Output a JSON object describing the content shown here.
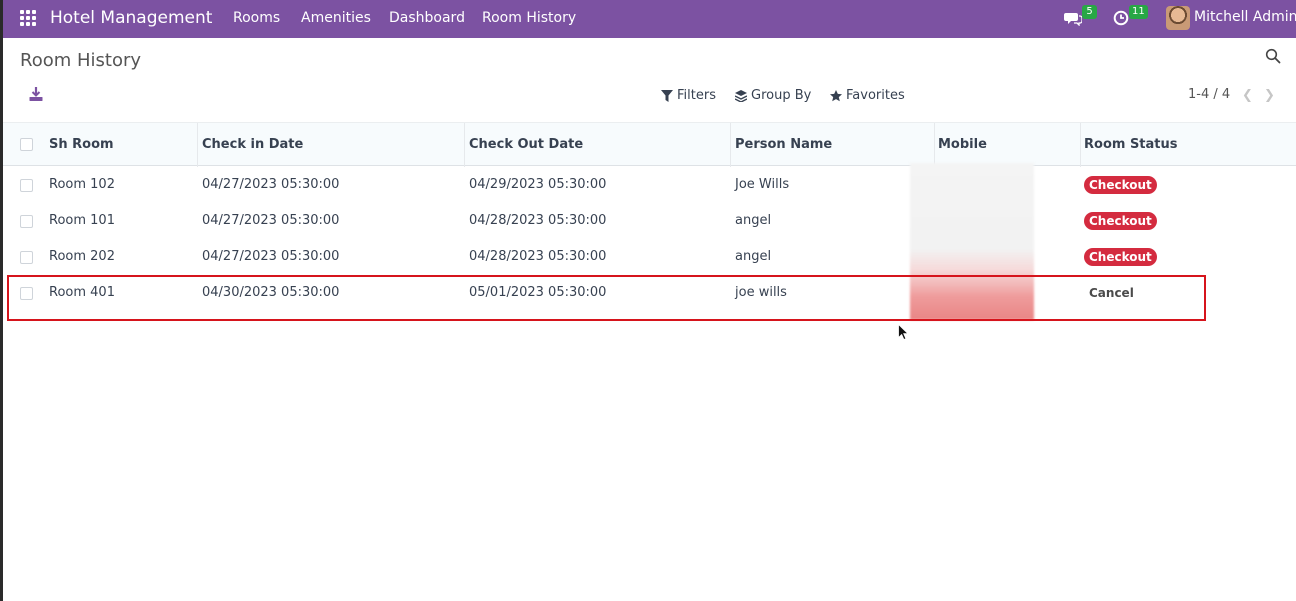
{
  "navbar": {
    "brand": "Hotel Management",
    "menu": [
      "Rooms",
      "Amenities",
      "Dashboard",
      "Room History"
    ],
    "messages_count": "5",
    "activities_count": "11",
    "user_name": "Mitchell Admin"
  },
  "control": {
    "title": "Room History",
    "filters_label": "Filters",
    "group_by_label": "Group By",
    "favorites_label": "Favorites",
    "pager": "1-4 / 4"
  },
  "table": {
    "columns": [
      "Sh Room",
      "Check in Date",
      "Check Out Date",
      "Person Name",
      "Mobile",
      "Room Status"
    ],
    "rows": [
      {
        "room": "Room 102",
        "check_in": "04/27/2023 05:30:00",
        "check_out": "04/29/2023 05:30:00",
        "person": "Joe Wills",
        "mobile": "",
        "status": "Checkout"
      },
      {
        "room": "Room 101",
        "check_in": "04/27/2023 05:30:00",
        "check_out": "04/28/2023 05:30:00",
        "person": "angel",
        "mobile": "",
        "status": "Checkout"
      },
      {
        "room": "Room 202",
        "check_in": "04/27/2023 05:30:00",
        "check_out": "04/28/2023 05:30:00",
        "person": "angel",
        "mobile": "",
        "status": "Checkout"
      },
      {
        "room": "Room 401",
        "check_in": "04/30/2023 05:30:00",
        "check_out": "05/01/2023 05:30:00",
        "person": "joe wills",
        "mobile": "",
        "status": "Cancel"
      }
    ]
  },
  "colors": {
    "navbar": "#7c52a2",
    "status_checkout": "#d42b3f",
    "badge": "#28a745",
    "highlight": "#d6141c"
  },
  "icons": [
    "apps-icon",
    "chat-icon",
    "clock-icon",
    "search-icon",
    "download-icon",
    "filter-icon",
    "layers-icon",
    "star-icon"
  ]
}
